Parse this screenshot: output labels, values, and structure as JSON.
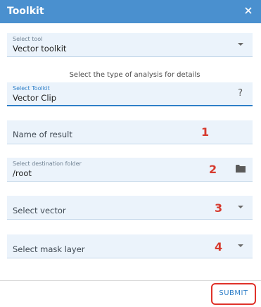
{
  "window": {
    "title": "Toolkit",
    "close_icon": "close-icon"
  },
  "tool_select": {
    "label": "Select tool",
    "value": "Vector toolkit"
  },
  "hint": "Select the type of analysis for details",
  "toolkit_select": {
    "label": "Select Toolkit",
    "value": "Vector Clip",
    "help": "?"
  },
  "result_name": {
    "placeholder": "Name of result"
  },
  "destination": {
    "label": "Select destination folder",
    "value": "/root",
    "icon": "folder-icon"
  },
  "vector_select": {
    "placeholder": "Select vector"
  },
  "mask_select": {
    "placeholder": "Select mask layer"
  },
  "annotations": [
    "1",
    "2",
    "3",
    "4"
  ],
  "submit_label": "SUBMIT",
  "colors": {
    "header": "#4a90cf",
    "field_bg": "#ebf3fb",
    "accent": "#2f7fc8",
    "annotation": "#d63a2e"
  }
}
